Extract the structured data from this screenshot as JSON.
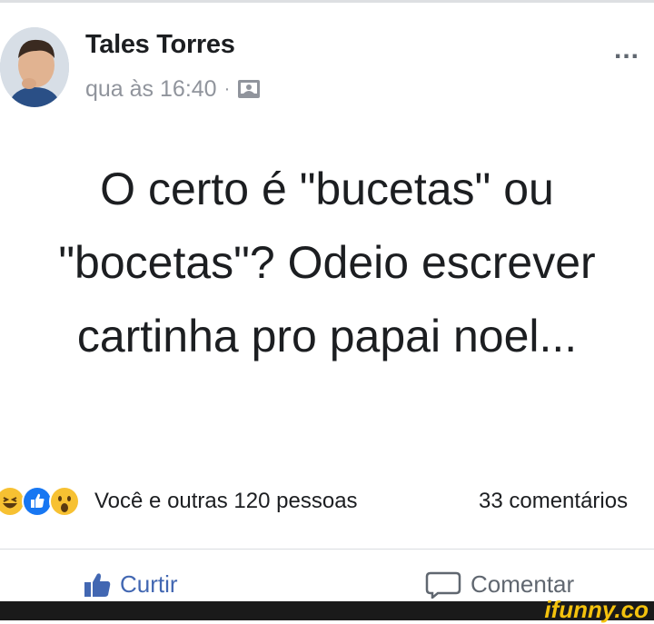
{
  "post": {
    "author": "Tales Torres",
    "timestamp": "qua às 16:40",
    "separator": "·",
    "privacy_icon": "photo-icon",
    "more_label": "...",
    "text": "O certo é \"bucetas\" ou \"bocetas\"? Odeio escrever cartinha pro papai noel..."
  },
  "reactions": {
    "icons": [
      "haha-icon",
      "like-icon",
      "wow-icon"
    ],
    "summary": "Você e outras 120 pessoas",
    "comments": "33 comentários"
  },
  "actions": {
    "like": "Curtir",
    "comment": "Comentar"
  },
  "watermark": "ifunny.co",
  "colors": {
    "link_blue": "#4267b2",
    "secondary_text": "#90949c",
    "primary_text": "#1c1e21",
    "haha_yellow": "#f7c132",
    "like_blue": "#1877f2"
  }
}
